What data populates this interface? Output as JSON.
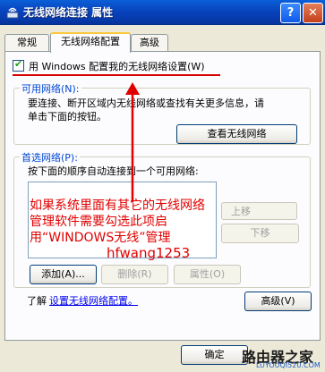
{
  "window": {
    "title": "无线网络连接 属性"
  },
  "tabs": [
    "常规",
    "无线网络配置",
    "高级"
  ],
  "use_windows_checkbox": {
    "label": "用 Windows 配置我的无线网络设置(W)",
    "checked": true
  },
  "available": {
    "title": "可用网络(N):",
    "desc_line1": "要连接、断开区域内无线网络或查找有关更多信息，请",
    "desc_line2": "单击下面的按钮。",
    "view_button": "查看无线网络"
  },
  "preferred": {
    "title": "首选网络(P):",
    "desc": "按下面的顺序自动连接到一个可用网络:",
    "move_up_partial": "上移",
    "move_down_partial": "下移",
    "add_button": "添加(A)...",
    "remove_button": "删除(R)",
    "props_button": "属性(O)"
  },
  "learn": {
    "prefix": "了解",
    "link": "设置无线网络配置。",
    "advanced_button": "高级(V)"
  },
  "annotation": {
    "text": "如果系统里面有其它的无线网络管理软件需要勾选此项启用“WINDOWS无线”管理",
    "author": "hfwang1253",
    "color": "#E00000"
  },
  "footer": {
    "ok_button": "确定"
  },
  "watermark": {
    "main": "路由器之家",
    "sub": "LUYOUQI520.COM"
  }
}
